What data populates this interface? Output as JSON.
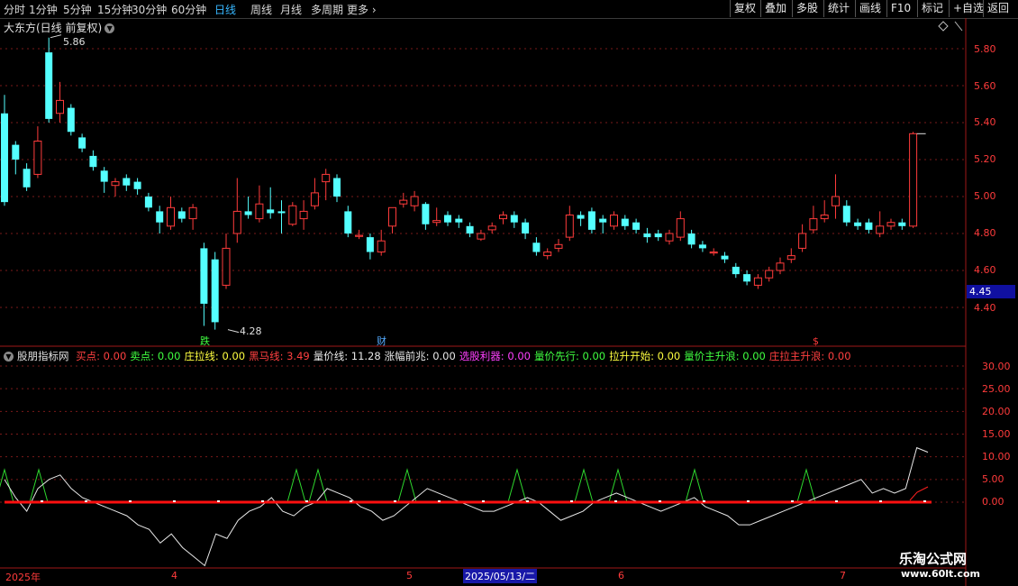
{
  "toolbar": {
    "tabs": [
      "分时",
      "1分钟",
      "5分钟",
      "15分钟",
      "30分钟",
      "60分钟",
      "日线",
      "周线",
      "月线",
      "多周期",
      "更多"
    ],
    "active": "日线",
    "right_buttons": [
      "复权",
      "叠加",
      "多股",
      "统计",
      "画线",
      "F10",
      "标记",
      "+自选",
      "返回"
    ]
  },
  "chart_title": "大东方(日线 前复权)",
  "price_axis": [
    "5.80",
    "5.60",
    "5.40",
    "5.20",
    "5.00",
    "4.80",
    "4.60",
    "4.40"
  ],
  "current_price": "4.45",
  "high_label": "5.86",
  "low_label": "4.28",
  "markers": {
    "die": "跌",
    "cai": "财",
    "dollar": "$"
  },
  "indicator": {
    "name": "股朋指标网",
    "items": [
      {
        "label": "买点: 0.00",
        "color": "#ff4040"
      },
      {
        "label": "卖点: 0.00",
        "color": "#40ff40"
      },
      {
        "label": "庄拉线: 0.00",
        "color": "#ffff40"
      },
      {
        "label": "黑马线: 3.49",
        "color": "#ff4040"
      },
      {
        "label": "量价线: 11.28",
        "color": "#e8e8e8"
      },
      {
        "label": "涨幅前兆: 0.00",
        "color": "#e8e8e8"
      },
      {
        "label": "选股利器: 0.00",
        "color": "#ff40ff"
      },
      {
        "label": "量价先行: 0.00",
        "color": "#40ff40"
      },
      {
        "label": "拉升开始: 0.00",
        "color": "#ffff40"
      },
      {
        "label": "量价主升浪: 0.00",
        "color": "#40ff40"
      },
      {
        "label": "庄拉主升浪: 0.00",
        "color": "#ff4040"
      }
    ],
    "axis": [
      "30.00",
      "25.00",
      "20.00",
      "15.00",
      "10.00",
      "5.00",
      "0.00"
    ]
  },
  "time_axis": {
    "labels": [
      "2025年",
      "4",
      "5",
      "6",
      "7"
    ],
    "selected": "2025/05/13/二"
  },
  "watermark": {
    "line1": "乐淘公式网",
    "line2": "www.60lt.com"
  },
  "colors": {
    "up": "#ff3b3b",
    "down": "#54ffff",
    "grid": "#7a1a1a",
    "red_line": "#ff1010"
  },
  "chart_data": {
    "type": "candlestick",
    "y_range": [
      4.2,
      6.0
    ],
    "candles": [
      [
        5.45,
        4.97,
        5.55,
        4.95
      ],
      [
        5.28,
        5.2,
        5.3,
        5.12
      ],
      [
        5.15,
        5.05,
        5.18,
        5.03
      ],
      [
        5.12,
        5.3,
        5.38,
        5.1
      ],
      [
        5.78,
        5.42,
        5.86,
        5.4
      ],
      [
        5.45,
        5.52,
        5.62,
        5.4
      ],
      [
        5.48,
        5.35,
        5.5,
        5.33
      ],
      [
        5.32,
        5.26,
        5.34,
        5.24
      ],
      [
        5.22,
        5.16,
        5.25,
        5.14
      ],
      [
        5.14,
        5.08,
        5.16,
        5.02
      ],
      [
        5.06,
        5.08,
        5.1,
        5.0
      ],
      [
        5.1,
        5.06,
        5.12,
        5.03
      ],
      [
        5.08,
        5.04,
        5.1,
        5.01
      ],
      [
        5.0,
        4.94,
        5.02,
        4.92
      ],
      [
        4.92,
        4.86,
        4.95,
        4.8
      ],
      [
        4.84,
        4.94,
        5.0,
        4.82
      ],
      [
        4.92,
        4.88,
        4.94,
        4.86
      ],
      [
        4.88,
        4.94,
        4.96,
        4.82
      ],
      [
        4.72,
        4.42,
        4.75,
        4.3
      ],
      [
        4.66,
        4.32,
        4.7,
        4.28
      ],
      [
        4.52,
        4.72,
        4.8,
        4.5
      ],
      [
        4.8,
        4.92,
        5.1,
        4.75
      ],
      [
        4.92,
        4.9,
        5.0,
        4.88
      ],
      [
        4.88,
        4.96,
        5.06,
        4.86
      ],
      [
        4.93,
        4.91,
        5.05,
        4.88
      ],
      [
        4.92,
        4.91,
        4.98,
        4.8
      ],
      [
        4.85,
        4.95,
        4.97,
        4.84
      ],
      [
        4.88,
        4.92,
        4.98,
        4.82
      ],
      [
        4.95,
        5.02,
        5.1,
        4.93
      ],
      [
        5.08,
        5.12,
        5.15,
        4.98
      ],
      [
        5.1,
        5.0,
        5.12,
        4.97
      ],
      [
        4.92,
        4.8,
        4.95,
        4.78
      ],
      [
        4.79,
        4.79,
        4.82,
        4.77
      ],
      [
        4.78,
        4.7,
        4.8,
        4.66
      ],
      [
        4.7,
        4.76,
        4.82,
        4.68
      ],
      [
        4.84,
        4.94,
        4.92,
        4.8
      ],
      [
        4.96,
        4.98,
        5.02,
        4.94
      ],
      [
        4.95,
        5.0,
        5.03,
        4.92
      ],
      [
        4.96,
        4.85,
        4.97,
        4.82
      ],
      [
        4.86,
        4.87,
        4.94,
        4.84
      ],
      [
        4.9,
        4.86,
        4.92,
        4.84
      ],
      [
        4.88,
        4.86,
        4.9,
        4.83
      ],
      [
        4.84,
        4.8,
        4.86,
        4.78
      ],
      [
        4.77,
        4.8,
        4.82,
        4.76
      ],
      [
        4.82,
        4.84,
        4.86,
        4.8
      ],
      [
        4.88,
        4.9,
        4.92,
        4.85
      ],
      [
        4.9,
        4.86,
        4.92,
        4.83
      ],
      [
        4.86,
        4.8,
        4.88,
        4.77
      ],
      [
        4.75,
        4.7,
        4.78,
        4.68
      ],
      [
        4.68,
        4.7,
        4.72,
        4.66
      ],
      [
        4.72,
        4.74,
        4.77,
        4.7
      ],
      [
        4.78,
        4.9,
        4.95,
        4.76
      ],
      [
        4.9,
        4.88,
        4.92,
        4.84
      ],
      [
        4.92,
        4.82,
        4.94,
        4.8
      ],
      [
        4.88,
        4.86,
        4.9,
        4.8
      ],
      [
        4.84,
        4.9,
        4.92,
        4.82
      ],
      [
        4.88,
        4.84,
        4.9,
        4.82
      ],
      [
        4.86,
        4.82,
        4.88,
        4.8
      ],
      [
        4.8,
        4.78,
        4.83,
        4.75
      ],
      [
        4.8,
        4.78,
        4.82,
        4.76
      ],
      [
        4.76,
        4.8,
        4.82,
        4.74
      ],
      [
        4.78,
        4.88,
        4.92,
        4.76
      ],
      [
        4.8,
        4.74,
        4.82,
        4.72
      ],
      [
        4.74,
        4.72,
        4.76,
        4.7
      ],
      [
        4.7,
        4.7,
        4.72,
        4.68
      ],
      [
        4.68,
        4.66,
        4.7,
        4.64
      ],
      [
        4.62,
        4.58,
        4.64,
        4.56
      ],
      [
        4.58,
        4.54,
        4.6,
        4.52
      ],
      [
        4.52,
        4.56,
        4.58,
        4.5
      ],
      [
        4.56,
        4.6,
        4.62,
        4.54
      ],
      [
        4.6,
        4.64,
        4.67,
        4.58
      ],
      [
        4.66,
        4.68,
        4.72,
        4.64
      ],
      [
        4.72,
        4.8,
        4.85,
        4.7
      ],
      [
        4.82,
        4.88,
        4.95,
        4.8
      ],
      [
        4.88,
        4.9,
        4.98,
        4.86
      ],
      [
        4.95,
        5.0,
        5.12,
        4.88
      ],
      [
        4.95,
        4.86,
        4.98,
        4.84
      ],
      [
        4.86,
        4.84,
        4.88,
        4.82
      ],
      [
        4.86,
        4.82,
        4.88,
        4.8
      ],
      [
        4.8,
        4.84,
        4.92,
        4.78
      ],
      [
        4.84,
        4.86,
        4.88,
        4.82
      ],
      [
        4.86,
        4.84,
        4.88,
        4.82
      ],
      [
        4.84,
        5.34,
        5.35,
        4.83
      ]
    ],
    "indicator_values": {
      "white": [
        5,
        1,
        -2,
        3,
        5,
        6,
        3,
        1,
        0,
        -1,
        -2,
        -3,
        -5,
        -6,
        -9,
        -7,
        -10,
        -12,
        -14,
        -7,
        -8,
        -4,
        -2,
        -1,
        1,
        -2,
        -3,
        -1,
        0,
        3,
        2,
        1,
        -1,
        -2,
        -4,
        -3,
        -1,
        1,
        3,
        2,
        1,
        0,
        -1,
        -2,
        -2,
        -1,
        0,
        1,
        0,
        -2,
        -4,
        -3,
        -2,
        0,
        1,
        2,
        1,
        0,
        -1,
        -2,
        -1,
        0,
        1,
        -1,
        -2,
        -3,
        -5,
        -5,
        -4,
        -3,
        -2,
        -1,
        0,
        1,
        2,
        3,
        4,
        5,
        2,
        3,
        2,
        3,
        12,
        11
      ],
      "red_line_level": 0
    }
  }
}
